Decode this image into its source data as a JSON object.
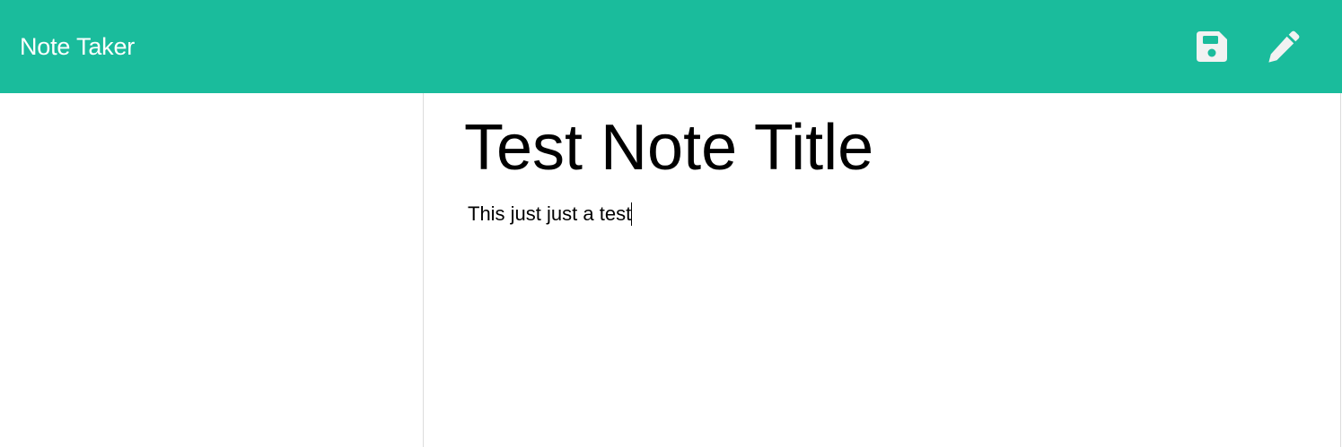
{
  "colors": {
    "navbar_background": "#1abc9c",
    "navbar_text": "#ffffff",
    "icon_color": "#f2f2f2"
  },
  "navbar": {
    "brand": "Note Taker",
    "icons": [
      "save-icon",
      "pencil-icon"
    ]
  },
  "note": {
    "title": "Test Note Title",
    "body": "This just just a test"
  }
}
